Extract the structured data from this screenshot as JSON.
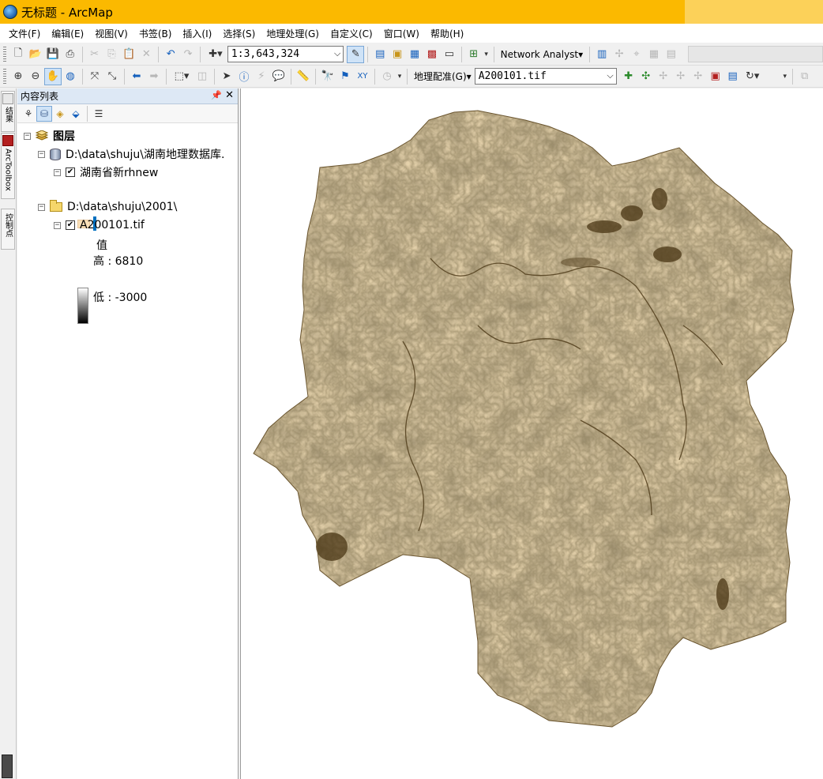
{
  "window": {
    "title": "无标题 - ArcMap"
  },
  "menu": [
    "文件(F)",
    "编辑(E)",
    "视图(V)",
    "书签(B)",
    "插入(I)",
    "选择(S)",
    "地理处理(G)",
    "自定义(C)",
    "窗口(W)",
    "帮助(H)"
  ],
  "toolbar1": {
    "scale": "1:3,643,324",
    "network_analyst": "Network Analyst"
  },
  "toolbar2": {
    "georef_label": "地理配准(G)",
    "georef_layer": "A200101.tif"
  },
  "left_tabs": {
    "results": "结果",
    "arctoolbox": "ArcToolbox",
    "control": "控制点"
  },
  "toc": {
    "title": "内容列表",
    "root": "图层",
    "group1": "D:\\data\\shuju\\湖南地理数据库.",
    "layer1": "湖南省新rhnew",
    "group2": "D:\\data\\shuju\\2001\\",
    "layer2": "A200101.tif",
    "legend_title": "值",
    "legend_high": "高 : 6810",
    "legend_low": "低 : -3000"
  },
  "colors": {
    "title_bar": "#fbb900",
    "raster": "#9e8557",
    "outline": "#0070c0"
  },
  "icons": [
    "arcmap-app-icon",
    "new-doc-icon",
    "open-icon",
    "save-icon",
    "print-icon",
    "cut-icon",
    "copy-icon",
    "paste-icon",
    "delete-icon",
    "undo-icon",
    "redo-icon",
    "add-data-icon",
    "zoom-in-icon",
    "zoom-out-icon",
    "pan-icon",
    "globe-icon",
    "select-arrow-icon",
    "identify-icon",
    "find-icon",
    "pin-icon",
    "close-icon"
  ]
}
